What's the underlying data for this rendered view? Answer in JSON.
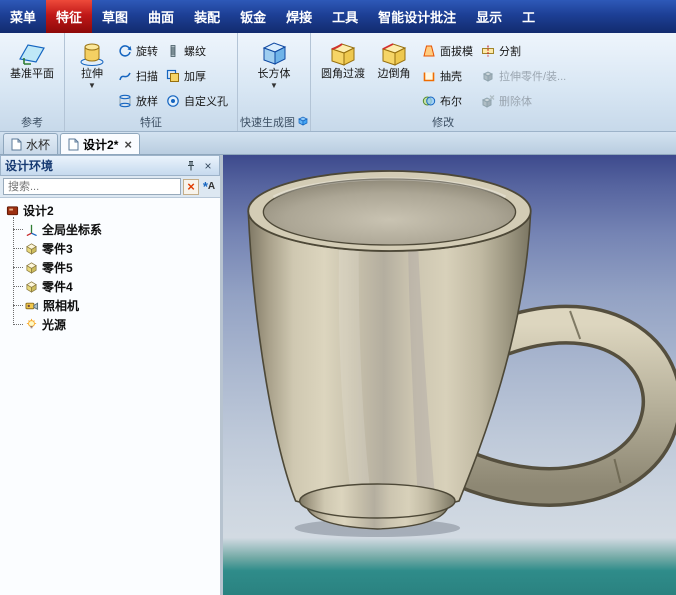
{
  "menubar": {
    "items": [
      "菜单",
      "特征",
      "草图",
      "曲面",
      "装配",
      "钣金",
      "焊接",
      "工具",
      "智能设计批注",
      "显示",
      "工"
    ],
    "active_item": "特征"
  },
  "ribbon": {
    "group_labels": {
      "reference": "参考",
      "feature": "特征",
      "quick_gen": "快速生成图",
      "modify": "修改"
    },
    "buttons": {
      "datum_plane": "基准平面",
      "extrude": "拉伸",
      "revolve": "旋转",
      "sweep": "扫描",
      "loft": "放样",
      "thread": "螺纹",
      "thicken": "加厚",
      "custom_hole": "自定义孔",
      "box": "长方体",
      "fillet": "圆角过渡",
      "chamfer": "边倒角",
      "draft": "面拔模",
      "shell": "抽壳",
      "boolean": "布尔",
      "split": "分割",
      "extrude_part": "拉伸零件/装...",
      "delete_body": "删除体"
    },
    "disabled_buttons": [
      "extrude_part",
      "delete_body"
    ]
  },
  "doc_tabs": {
    "tabs": [
      {
        "label": "水杯",
        "active": false
      },
      {
        "label": "设计2*",
        "active": true
      }
    ]
  },
  "left_panel": {
    "title": "设计环境",
    "search_placeholder": "搜索...",
    "tree": {
      "root": "设计2",
      "items": [
        "全局坐标系",
        "零件3",
        "零件5",
        "零件4",
        "照相机",
        "光源"
      ]
    }
  },
  "viewport": {
    "model_name": "mug",
    "colors": {
      "mug_body": "#c9c2ab",
      "background_top": "#3d4a8d",
      "background_bottom": "#2a8280"
    }
  },
  "icons": {
    "dropdown_arrow": "▼",
    "close": "×",
    "clear_search": "×",
    "search_star": "*",
    "search_letter": "A"
  }
}
